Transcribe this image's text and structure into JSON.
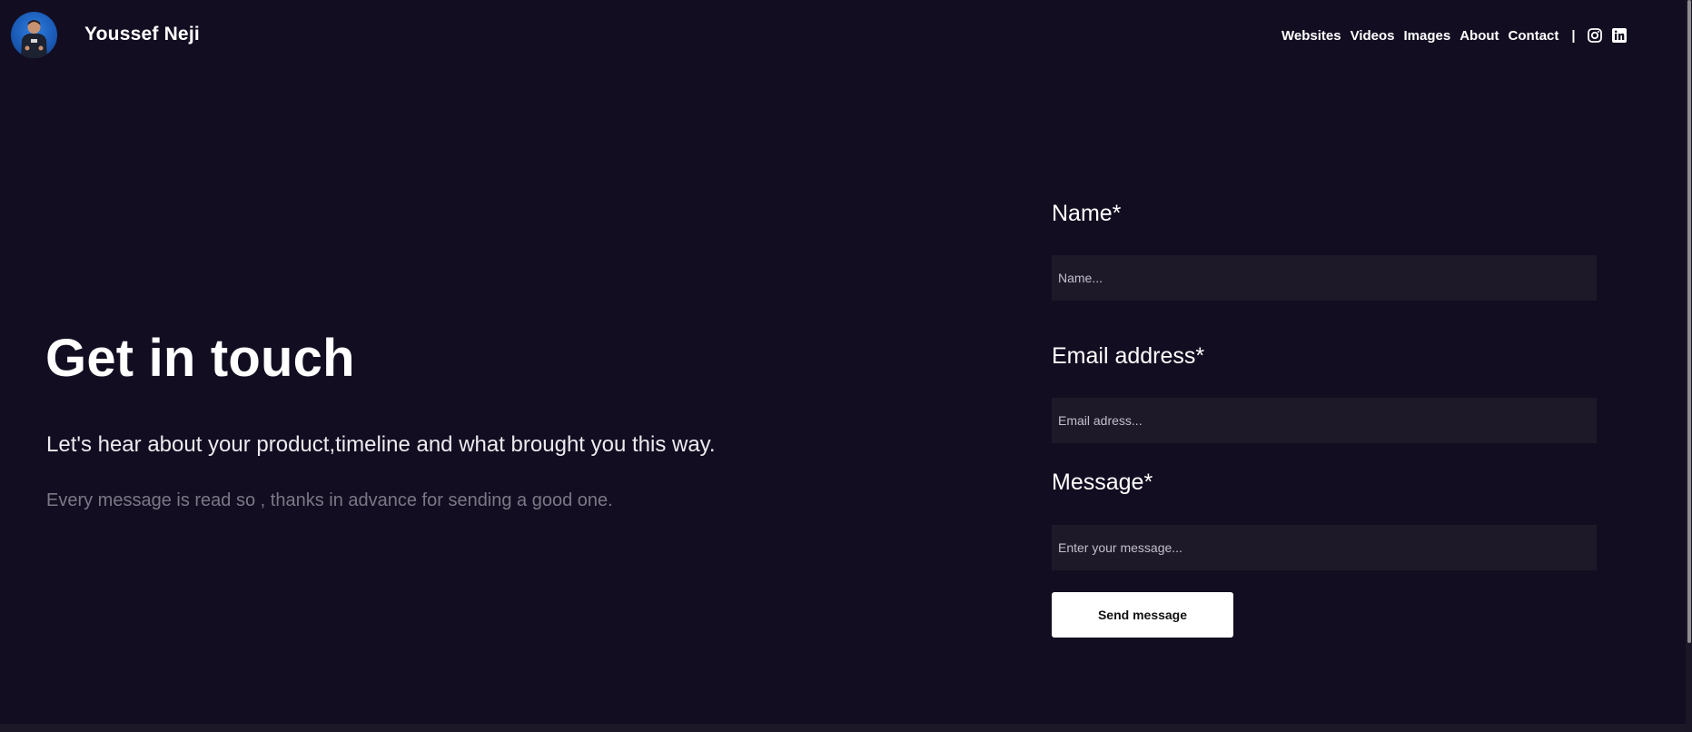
{
  "header": {
    "brand_name": "Youssef Neji",
    "nav": [
      {
        "label": "Websites"
      },
      {
        "label": "Videos"
      },
      {
        "label": "Images"
      },
      {
        "label": "About"
      },
      {
        "label": "Contact"
      }
    ],
    "separator": "|",
    "social_icons": [
      "instagram-icon",
      "linkedin-icon"
    ]
  },
  "hero": {
    "title": "Get in touch",
    "subtitle": "Let's hear about your product,timeline and what brought you this way.",
    "note": "Every message is read so , thanks in advance for sending a good one."
  },
  "form": {
    "name_label": "Name*",
    "name_placeholder": "Name...",
    "email_label": "Email address*",
    "email_placeholder": "Email adress...",
    "message_label": "Message*",
    "message_placeholder": "Enter your message...",
    "submit_label": "Send message"
  },
  "colors": {
    "background": "#130d21",
    "input_background": "#1e1929",
    "button_background": "#ffffff",
    "muted_text": "#7b7786"
  }
}
